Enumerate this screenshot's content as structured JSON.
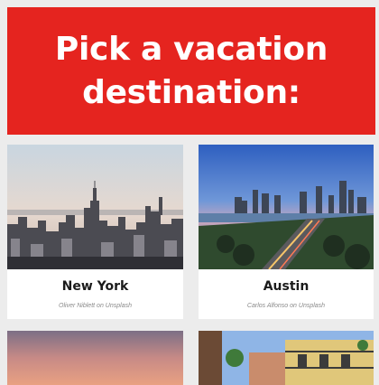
{
  "header": {
    "title": "Pick a vacation destination:"
  },
  "cards": [
    {
      "city": "New York",
      "credit_author": "Oliver Niblett",
      "credit_on": "on",
      "credit_source": "Unsplash",
      "image": "new-york-skyline-photo"
    },
    {
      "city": "Austin",
      "credit_author": "Carlos Alfonso",
      "credit_on": "on",
      "credit_source": "Unsplash",
      "image": "austin-skyline-photo"
    },
    {
      "image": "sunset-photo"
    },
    {
      "image": "street-balconies-photo"
    }
  ],
  "colors": {
    "accent": "#e5241f",
    "card_bg": "#ffffff",
    "page_bg": "#ececec"
  }
}
